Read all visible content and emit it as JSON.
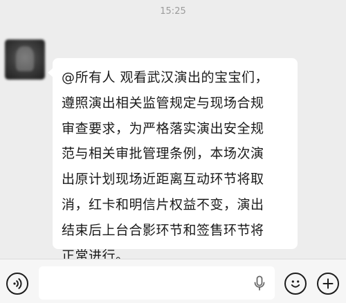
{
  "status": {
    "time": "15:25"
  },
  "message": {
    "sender_name": "",
    "sender_tag": "",
    "text_lines": [
      "@所有人  观看武汉演出的宝宝们，",
      "遵照演出相关监管规定与现场合规",
      "审查要求，为严格落实演出安全规",
      "范与相关审批管理条例，本场次演",
      "出原计划现场近距离互动环节将取",
      "消，红卡和明信片权益不变，演出",
      "结束后上台合影环节和签售环节将",
      "正常进行。"
    ]
  },
  "input_bar": {
    "placeholder": ""
  },
  "icons": {
    "voice": "voice-icon",
    "mic": "mic-icon",
    "emoji": "emoji-icon",
    "plus": "plus-icon"
  },
  "colors": {
    "background": "#ededed",
    "bubble": "#ffffff",
    "text": "#1a1a1a",
    "timestamp": "#9b9b9b"
  }
}
